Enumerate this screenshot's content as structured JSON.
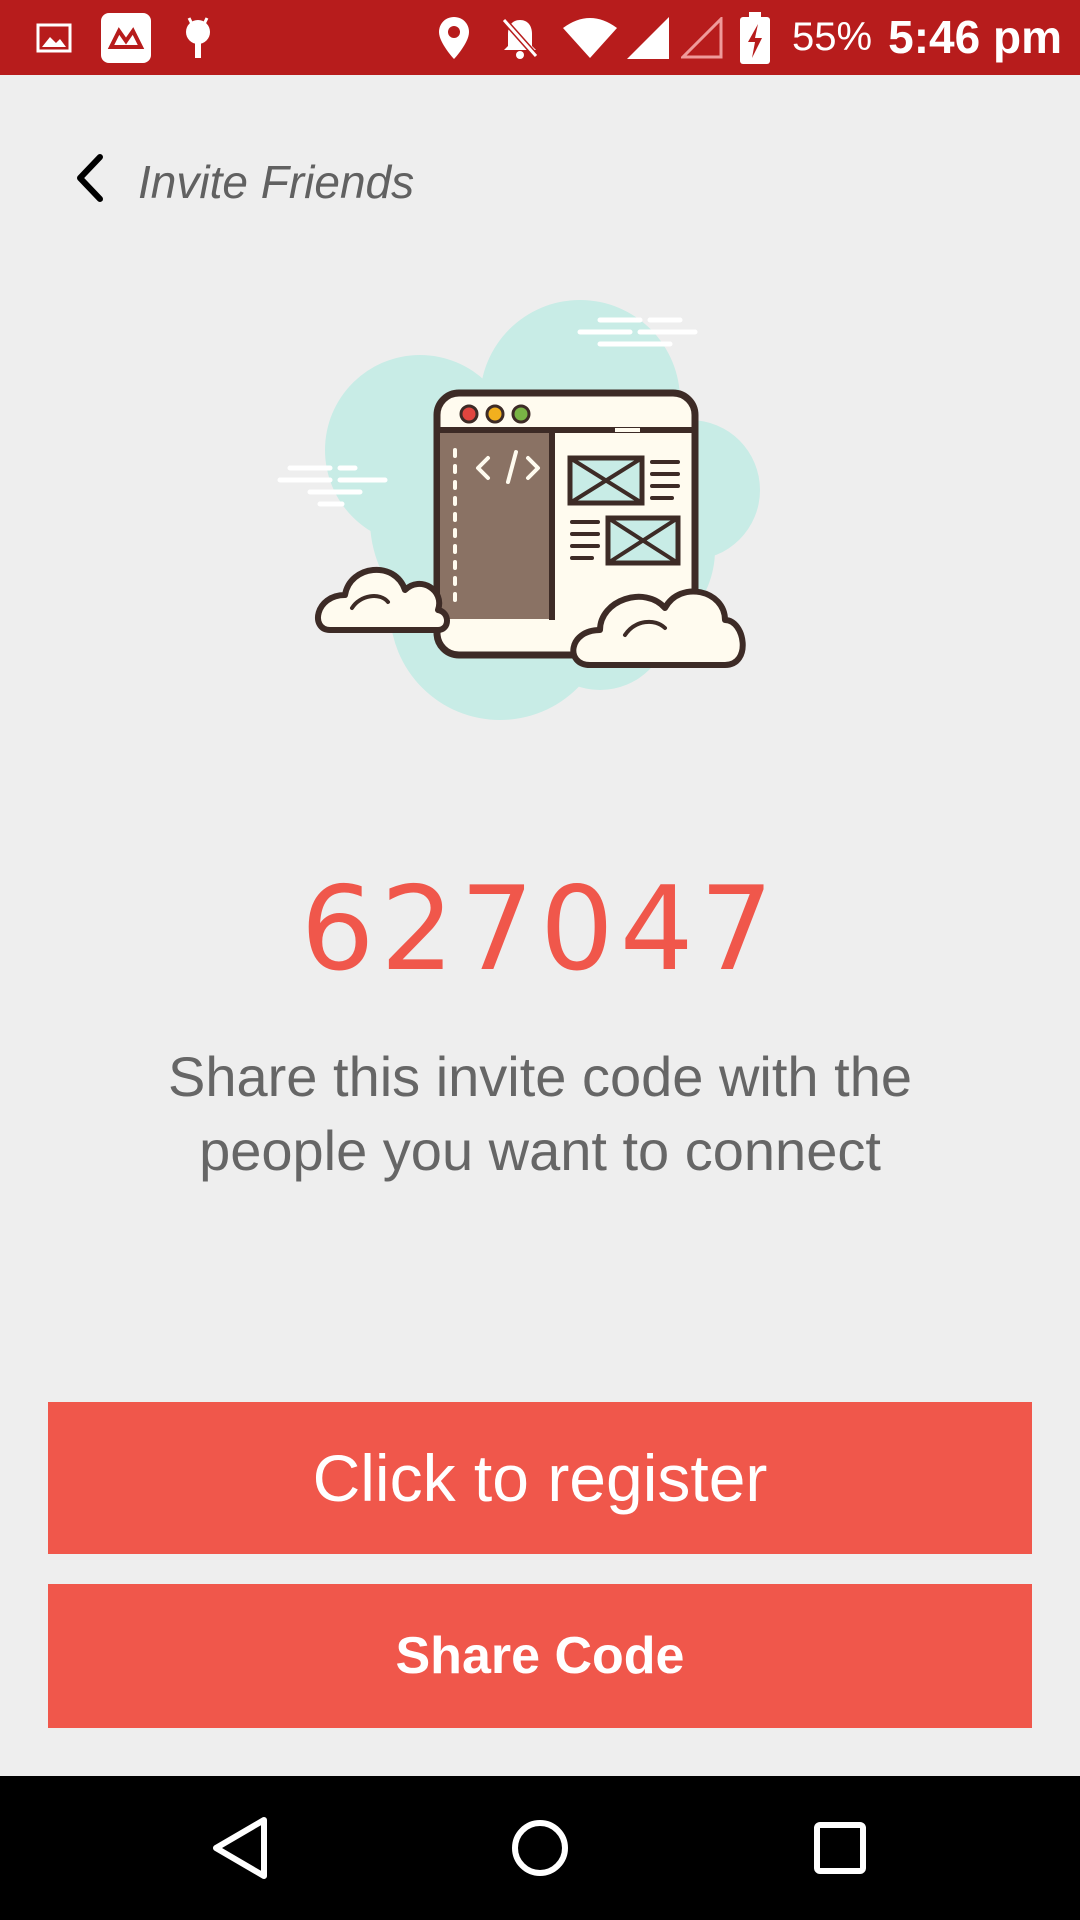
{
  "status_bar": {
    "battery_percent": "55%",
    "time": "5:46 pm",
    "color": "#b71c1c",
    "left_icons": [
      "image-icon",
      "app-logo-icon",
      "android-debug-icon"
    ],
    "right_icons": [
      "location-icon",
      "notifications-off-icon",
      "wifi-icon",
      "signal-icon",
      "signal-empty-icon",
      "battery-charging-icon"
    ]
  },
  "header": {
    "title": "Invite Friends",
    "back_icon": "chevron-left-icon"
  },
  "main": {
    "illustration": "web-browser-cloud-illustration",
    "invite_code": "627047",
    "description": "Share this invite code with the people you want to connect",
    "accent_color": "#f0574b"
  },
  "buttons": {
    "register_label": "Click to register",
    "share_label": "Share Code"
  },
  "nav_bar": {
    "icons": [
      "back-icon",
      "home-icon",
      "recents-icon"
    ]
  }
}
